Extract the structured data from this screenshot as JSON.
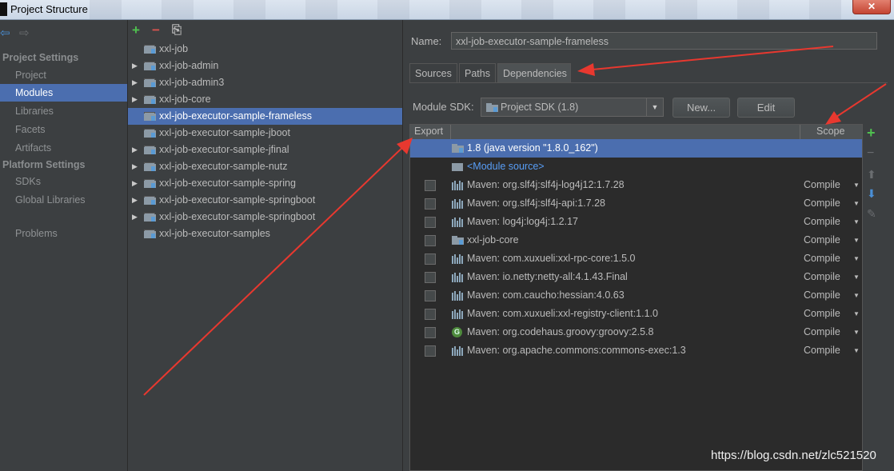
{
  "window": {
    "title": "Project Structure",
    "close_label": "✕"
  },
  "left_nav": {
    "project_settings_label": "Project Settings",
    "project_items": [
      "Project",
      "Modules",
      "Libraries",
      "Facets",
      "Artifacts"
    ],
    "selected": "Modules",
    "platform_settings_label": "Platform Settings",
    "platform_items": [
      "SDKs",
      "Global Libraries"
    ],
    "problems_label": "Problems"
  },
  "modules": {
    "toolbar": {
      "add": "+",
      "remove": "−",
      "copy": "⎘"
    },
    "items": [
      {
        "label": "xxl-job",
        "expandable": false
      },
      {
        "label": "xxl-job-admin",
        "expandable": true
      },
      {
        "label": "xxl-job-admin3",
        "expandable": true
      },
      {
        "label": "xxl-job-core",
        "expandable": true
      },
      {
        "label": "xxl-job-executor-sample-frameless",
        "expandable": false
      },
      {
        "label": "xxl-job-executor-sample-jboot",
        "expandable": false
      },
      {
        "label": "xxl-job-executor-sample-jfinal",
        "expandable": true
      },
      {
        "label": "xxl-job-executor-sample-nutz",
        "expandable": true
      },
      {
        "label": "xxl-job-executor-sample-spring",
        "expandable": true
      },
      {
        "label": "xxl-job-executor-sample-springboot",
        "expandable": true
      },
      {
        "label": "xxl-job-executor-sample-springboot",
        "expandable": true
      },
      {
        "label": "xxl-job-executor-samples",
        "expandable": false
      }
    ],
    "selected_index": 4
  },
  "detail": {
    "name_label": "Name:",
    "name_value": "xxl-job-executor-sample-frameless",
    "tabs": [
      "Sources",
      "Paths",
      "Dependencies"
    ],
    "active_tab": "Dependencies",
    "sdk_label": "Module SDK:",
    "sdk_value": "Project SDK (1.8)",
    "new_button": "New...",
    "edit_button": "Edit",
    "table": {
      "export_header": "Export",
      "scope_header": "Scope",
      "sdk_row": "1.8 (java version \"1.8.0_162\")",
      "source_row": "<Module source>",
      "rows": [
        {
          "label": "Maven: org.slf4j:slf4j-log4j12:1.7.28",
          "scope": "Compile",
          "icon": "maven-icon"
        },
        {
          "label": "Maven: org.slf4j:slf4j-api:1.7.28",
          "scope": "Compile",
          "icon": "maven-icon"
        },
        {
          "label": "Maven: log4j:log4j:1.2.17",
          "scope": "Compile",
          "icon": "maven-icon"
        },
        {
          "label": "xxl-job-core",
          "scope": "Compile",
          "icon": "module-folder-icon"
        },
        {
          "label": "Maven: com.xuxueli:xxl-rpc-core:1.5.0",
          "scope": "Compile",
          "icon": "maven-icon"
        },
        {
          "label": "Maven: io.netty:netty-all:4.1.43.Final",
          "scope": "Compile",
          "icon": "maven-icon"
        },
        {
          "label": "Maven: com.caucho:hessian:4.0.63",
          "scope": "Compile",
          "icon": "maven-icon"
        },
        {
          "label": "Maven: com.xuxueli:xxl-registry-client:1.1.0",
          "scope": "Compile",
          "icon": "maven-icon"
        },
        {
          "label": "Maven: org.codehaus.groovy:groovy:2.5.8",
          "scope": "Compile",
          "icon": "groovy-icon"
        },
        {
          "label": "Maven: org.apache.commons:commons-exec:1.3",
          "scope": "Compile",
          "icon": "maven-icon"
        }
      ]
    }
  },
  "watermark": "https://blog.csdn.net/zlc521520",
  "colors": {
    "selection": "#4b6eaf",
    "panel": "#3c3f41",
    "annotation_arrow": "#e8382f",
    "add_green": "#4fc04f",
    "remove_red": "#d9534f"
  }
}
